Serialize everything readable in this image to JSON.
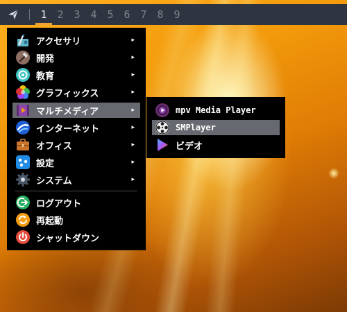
{
  "panel": {
    "workspaces": [
      "1",
      "2",
      "3",
      "4",
      "5",
      "6",
      "7",
      "8",
      "9"
    ],
    "active_workspace": "1",
    "accent_color": "#f0a33a"
  },
  "main_menu": {
    "items": [
      {
        "label": "アクセサリ",
        "icon": "accessories-icon",
        "has_submenu": true
      },
      {
        "label": "開発",
        "icon": "hammer-icon",
        "has_submenu": true
      },
      {
        "label": "教育",
        "icon": "education-icon",
        "has_submenu": true
      },
      {
        "label": "グラフィックス",
        "icon": "graphics-icon",
        "has_submenu": true
      },
      {
        "label": "マルチメディア",
        "icon": "multimedia-icon",
        "has_submenu": true,
        "highlighted": true
      },
      {
        "label": "インターネット",
        "icon": "internet-icon",
        "has_submenu": true
      },
      {
        "label": "オフィス",
        "icon": "briefcase-icon",
        "has_submenu": true
      },
      {
        "label": "設定",
        "icon": "settings-icon",
        "has_submenu": true
      },
      {
        "label": "システム",
        "icon": "gear-icon",
        "has_submenu": true
      }
    ],
    "actions": [
      {
        "label": "ログアウト",
        "icon": "logout-icon"
      },
      {
        "label": "再起動",
        "icon": "restart-icon"
      },
      {
        "label": "シャットダウン",
        "icon": "power-icon"
      }
    ],
    "submenu_arrow": "▸"
  },
  "sub_menu": {
    "items": [
      {
        "label": "mpv Media Player",
        "icon": "mpv-icon"
      },
      {
        "label": "SMPlayer",
        "icon": "smplayer-icon",
        "highlighted": true
      },
      {
        "label": "ビデオ",
        "icon": "video-icon"
      }
    ]
  },
  "colors": {
    "highlight": "#666a70",
    "menu_bg": "#000000",
    "panel_bg": "#2e3440"
  }
}
